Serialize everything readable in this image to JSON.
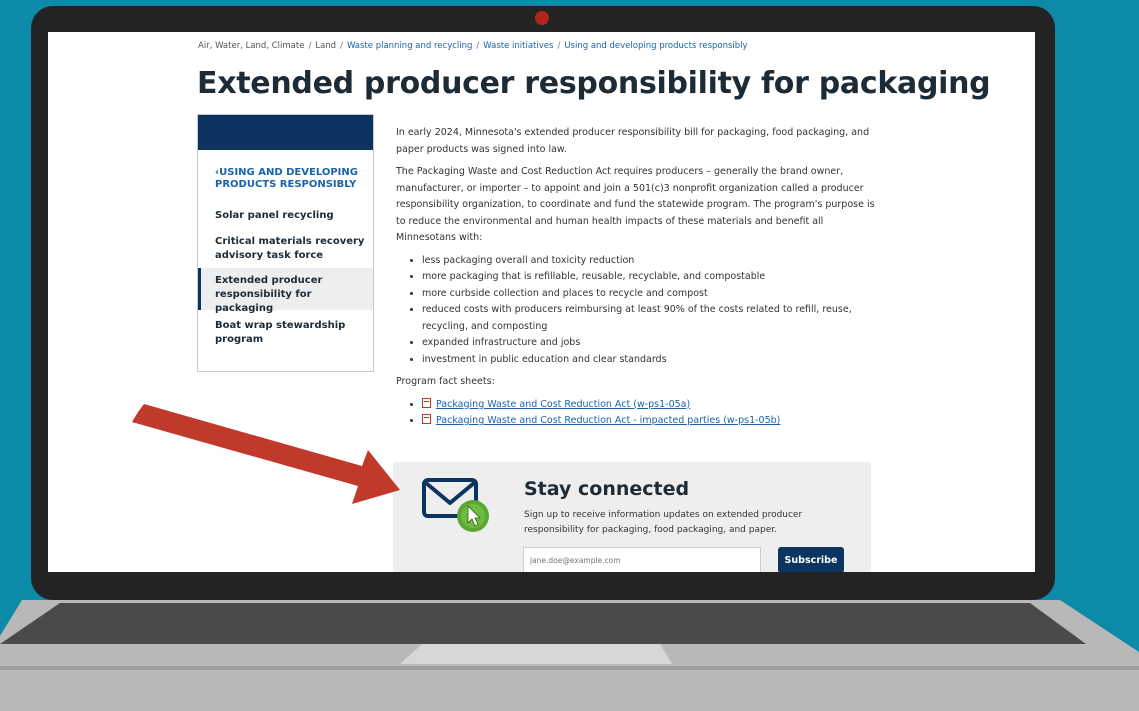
{
  "breadcrumb": {
    "items": [
      {
        "label": "Air, Water, Land, Climate",
        "link": false
      },
      {
        "label": "Land",
        "link": false
      },
      {
        "label": "Waste planning and recycling",
        "link": true
      },
      {
        "label": "Waste initiatives",
        "link": true
      },
      {
        "label": "Using and developing products responsibly",
        "link": true
      }
    ]
  },
  "page_title": "Extended producer responsibility for packaging",
  "sidenav": {
    "parent": "‹USING AND DEVELOPING PRODUCTS RESPONSIBLY",
    "items": [
      {
        "label": "Solar panel recycling"
      },
      {
        "label": "Critical materials recovery advisory task force"
      },
      {
        "label": "Extended producer responsibility for packaging"
      },
      {
        "label": "Boat wrap stewardship program"
      }
    ]
  },
  "content": {
    "intro": "In early 2024, Minnesota's extended producer responsibility bill for packaging, food packaging, and paper products was signed into law.",
    "para2": "The Packaging Waste and Cost Reduction Act requires producers – generally the brand owner, manufacturer, or importer – to appoint and join a 501(c)3 nonprofit organization called a producer responsibility organization, to coordinate and fund the statewide program. The program's purpose is to reduce the environmental and human health impacts of these materials and benefit all Minnesotans with:",
    "bullets": [
      "less packaging overall and toxicity reduction",
      "more packaging that is refillable, reusable, recyclable, and compostable",
      "more curbside collection and places to recycle and compost",
      "reduced costs with producers reimbursing at least 90% of the costs related to refill, reuse, recycling, and composting",
      "expanded infrastructure and jobs",
      "investment in public education and clear standards"
    ],
    "fact_sheets_label": "Program fact sheets:",
    "fact_sheets": [
      "Packaging Waste and Cost Reduction Act (w-ps1-05a)",
      "Packaging Waste and Cost Reduction Act - impacted parties (w-ps1-05b)"
    ]
  },
  "stay_connected": {
    "title": "Stay connected",
    "description": "Sign up to receive information updates on extended producer responsibility for packaging, food packaging, and paper.",
    "email_placeholder": "jane.doe@example.com",
    "subscribe_label": "Subscribe"
  },
  "colors": {
    "background": "#0d8aa8",
    "nav_dark": "#0b3461",
    "link": "#1a63a8",
    "arrow": "#c0392b",
    "cursor_green": "#5aa832"
  }
}
